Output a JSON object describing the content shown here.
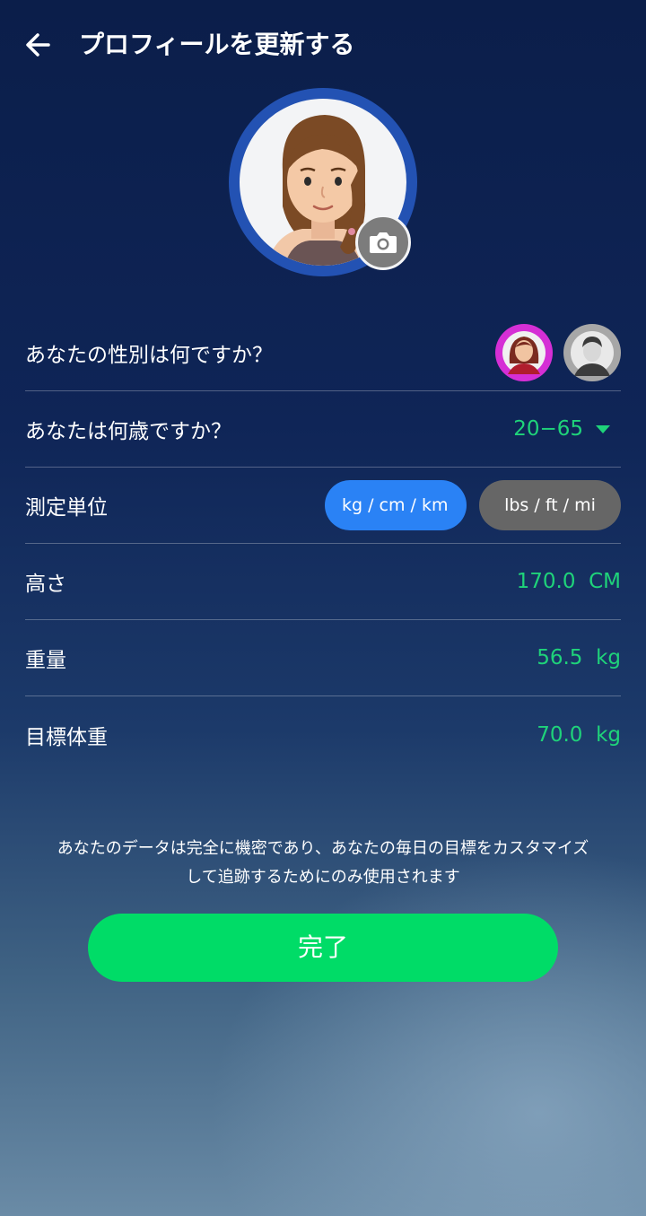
{
  "header": {
    "title": "プロフィールを更新する",
    "back_icon": "arrow-left-icon"
  },
  "avatar": {
    "image": "female-avatar-illustration",
    "camera_icon": "camera-icon",
    "ring_color": "#2352b3"
  },
  "gender": {
    "label": "あなたの性別は何ですか？",
    "options": [
      {
        "name": "female",
        "icon": "female-avatar-icon",
        "color": "#d52fd5",
        "selected": true
      },
      {
        "name": "male",
        "icon": "male-avatar-icon",
        "color": "#a7a7a7",
        "selected": false
      }
    ]
  },
  "age": {
    "label": "あなたは何歳ですか？",
    "value": "20−65",
    "icon": "dropdown-caret-icon"
  },
  "units": {
    "label": "測定単位",
    "metric": "kg / cm / km",
    "imperial": "lbs / ft / mi",
    "selected": "metric"
  },
  "height": {
    "label": "高さ",
    "value": "170.0  CM"
  },
  "weight": {
    "label": "重量",
    "value": "56.5  kg"
  },
  "target_weight": {
    "label": "目標体重",
    "value": "70.0  kg"
  },
  "notice": {
    "line1": "あなたのデータは完全に機密であり、あなたの毎日の目標をカスタマイズ",
    "line2": "して追跡するためにのみ使用されます"
  },
  "done_button": {
    "label": "完了"
  },
  "colors": {
    "accent_green": "#1fd37a",
    "button_green": "#00dc67",
    "metric_blue": "#2a82f5",
    "inactive_gray": "#666666"
  }
}
